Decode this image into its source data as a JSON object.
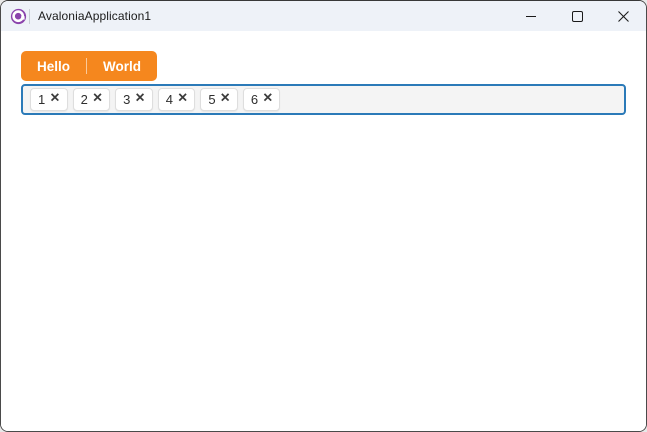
{
  "window": {
    "title": "AvaloniaApplication1",
    "controls": {
      "minimize": "minimize-icon",
      "maximize": "maximize-icon",
      "close": "close-icon"
    },
    "app_icon": "avalonia-logo-icon"
  },
  "split_button": {
    "left_label": "Hello",
    "right_label": "World"
  },
  "chips": {
    "items": [
      "1",
      "2",
      "3",
      "4",
      "5",
      "6"
    ],
    "remove_glyph": "×",
    "remove_icon": "close-x-icon"
  },
  "colors": {
    "accent_orange": "#F5871E",
    "focus_border_blue": "#2B7AB8",
    "titlebar_bg": "#EEF2F8",
    "avalonia_purple": "#8B44AC",
    "window_border": "#4A4A4A",
    "content_bg": "#FFFFFF",
    "chips_container_bg": "#F4F4F4",
    "chip_bg": "#FFFFFF",
    "chip_border": "#DEDEDE",
    "text_dark": "#1B1B1B"
  }
}
